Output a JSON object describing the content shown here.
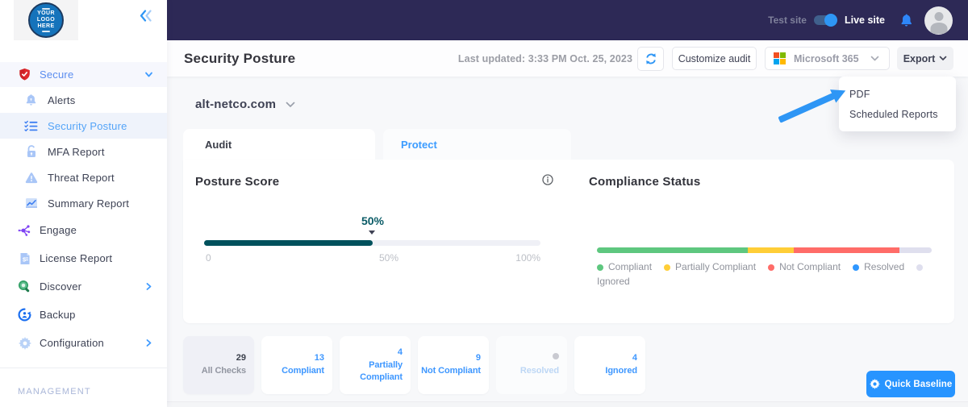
{
  "brand": {
    "logo_lines": [
      "YOUR",
      "LOGO",
      "HERE"
    ]
  },
  "topbar": {
    "test_site_label": "Test site",
    "live_site_label": "Live site",
    "toggle_state": "live"
  },
  "sidebar": {
    "items": [
      {
        "label": "Secure",
        "icon": "shield",
        "type": "secure",
        "chevron": "down"
      },
      {
        "label": "Alerts",
        "icon": "bell",
        "type": "sub"
      },
      {
        "label": "Security Posture",
        "icon": "checklist",
        "type": "sub",
        "selected": true
      },
      {
        "label": "MFA Report",
        "icon": "lock",
        "type": "sub"
      },
      {
        "label": "Threat Report",
        "icon": "warning",
        "type": "sub"
      },
      {
        "label": "Summary Report",
        "icon": "chart",
        "type": "sub"
      },
      {
        "label": "Engage",
        "icon": "network",
        "type": "main"
      },
      {
        "label": "License Report",
        "icon": "invoice",
        "type": "main"
      },
      {
        "label": "Discover",
        "icon": "search",
        "type": "main",
        "chevron": "right"
      },
      {
        "label": "Backup",
        "icon": "backup",
        "type": "main"
      },
      {
        "label": "Configuration",
        "icon": "gear",
        "type": "main",
        "chevron": "right"
      }
    ],
    "section_label": "MANAGEMENT"
  },
  "header": {
    "title": "Security Posture",
    "last_updated": "Last updated: 3:33 PM Oct. 25, 2023",
    "customize_button": "Customize audit",
    "platform_select": "Microsoft 365",
    "export_button": "Export"
  },
  "export_menu": {
    "items": [
      "PDF",
      "Scheduled Reports"
    ]
  },
  "main": {
    "domain": "alt-netco.com",
    "tabs": [
      {
        "label": "Audit",
        "active": true
      },
      {
        "label": "Protect",
        "active": false
      }
    ],
    "posture": {
      "title": "Posture Score",
      "score_label": "50%",
      "score_percent": 50,
      "scale": [
        "0",
        "50%",
        "100%"
      ],
      "fill_color": "#00515c"
    },
    "compliance": {
      "title": "Compliance Status",
      "segments": [
        {
          "label": "Compliant",
          "percent": 45.0,
          "color": "#5ec77f"
        },
        {
          "label": "Partially Compliant",
          "percent": 13.8,
          "color": "#ffce37"
        },
        {
          "label": "Not Compliant",
          "percent": 31.5,
          "color": "#ff6c68"
        },
        {
          "label": "Ignored",
          "percent": 9.7,
          "color": "#dfdfee"
        }
      ],
      "legend": [
        {
          "label": "Compliant",
          "color": "#5ec77f"
        },
        {
          "label": "Partially Compliant",
          "color": "#ffce37"
        },
        {
          "label": "Not Compliant",
          "color": "#ff6c68"
        },
        {
          "label": "Resolved",
          "color": "#2f97ff"
        },
        {
          "label": "Ignored",
          "color": "#dfdfee"
        }
      ]
    }
  },
  "summary_cards": [
    {
      "value": "29",
      "label": "All Checks",
      "variant": "gray"
    },
    {
      "value": "13",
      "label": "Compliant",
      "variant": "blue"
    },
    {
      "value": "4",
      "label": "Partially Compliant",
      "variant": "blue"
    },
    {
      "value": "9",
      "label": "Not Compliant",
      "variant": "blue"
    },
    {
      "value": "",
      "label": "Resolved",
      "variant": "muted"
    },
    {
      "value": "4",
      "label": "Ignored",
      "variant": "blue"
    }
  ],
  "quick_baseline": {
    "label": "Quick Baseline"
  }
}
